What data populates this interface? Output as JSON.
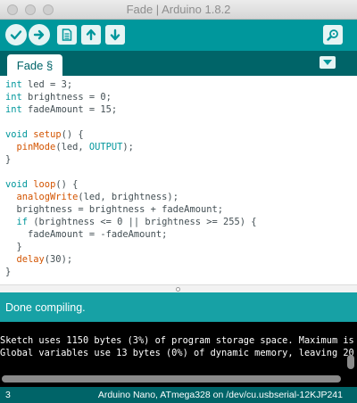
{
  "window": {
    "title": "Fade | Arduino 1.8.2"
  },
  "toolbar": {
    "verify": "checkmark-icon",
    "upload": "arrow-right-icon",
    "new": "document-icon",
    "open": "arrow-up-icon",
    "save": "arrow-down-icon",
    "serial_monitor": "magnifier-icon"
  },
  "tabs": [
    {
      "label": "Fade §"
    }
  ],
  "editor": {
    "lines": [
      [
        [
          "kw",
          "int"
        ],
        [
          "t",
          " led = 3;"
        ]
      ],
      [
        [
          "kw",
          "int"
        ],
        [
          "t",
          " brightness = 0;"
        ]
      ],
      [
        [
          "kw",
          "int"
        ],
        [
          "t",
          " fadeAmount = 15;"
        ]
      ],
      [],
      [
        [
          "kw",
          "void"
        ],
        [
          "t",
          " "
        ],
        [
          "fn",
          "setup"
        ],
        [
          "t",
          "() {"
        ]
      ],
      [
        [
          "t",
          "  "
        ],
        [
          "fn",
          "pinMode"
        ],
        [
          "t",
          "(led, "
        ],
        [
          "kw",
          "OUTPUT"
        ],
        [
          "t",
          ");"
        ]
      ],
      [
        [
          "t",
          "}"
        ]
      ],
      [],
      [
        [
          "kw",
          "void"
        ],
        [
          "t",
          " "
        ],
        [
          "fn",
          "loop"
        ],
        [
          "t",
          "() {"
        ]
      ],
      [
        [
          "t",
          "  "
        ],
        [
          "fn",
          "analogWrite"
        ],
        [
          "t",
          "(led, brightness);"
        ]
      ],
      [
        [
          "t",
          "  brightness = brightness + fadeAmount;"
        ]
      ],
      [
        [
          "t",
          "  "
        ],
        [
          "kw",
          "if"
        ],
        [
          "t",
          " (brightness <= 0 || brightness >= 255) {"
        ]
      ],
      [
        [
          "t",
          "    fadeAmount = -fadeAmount;"
        ]
      ],
      [
        [
          "t",
          "  }"
        ]
      ],
      [
        [
          "t",
          "  "
        ],
        [
          "fn",
          "delay"
        ],
        [
          "t",
          "(30);"
        ]
      ],
      [
        [
          "t",
          "}"
        ]
      ]
    ]
  },
  "status": {
    "message": "Done compiling."
  },
  "console": {
    "lines": [
      "Sketch uses 1150 bytes (3%) of program storage space. Maximum is",
      "Global variables use 13 bytes (0%) of dynamic memory, leaving 20"
    ]
  },
  "bottom_bar": {
    "line_number": "3",
    "board": "Arduino Nano, ATmega328 on /dev/cu.usbserial-12KJP241"
  },
  "colors": {
    "teal": "#00979c",
    "dark_teal": "#006468",
    "status_teal": "#17a1a5",
    "keyword": "#00979c",
    "function": "#d35400"
  }
}
